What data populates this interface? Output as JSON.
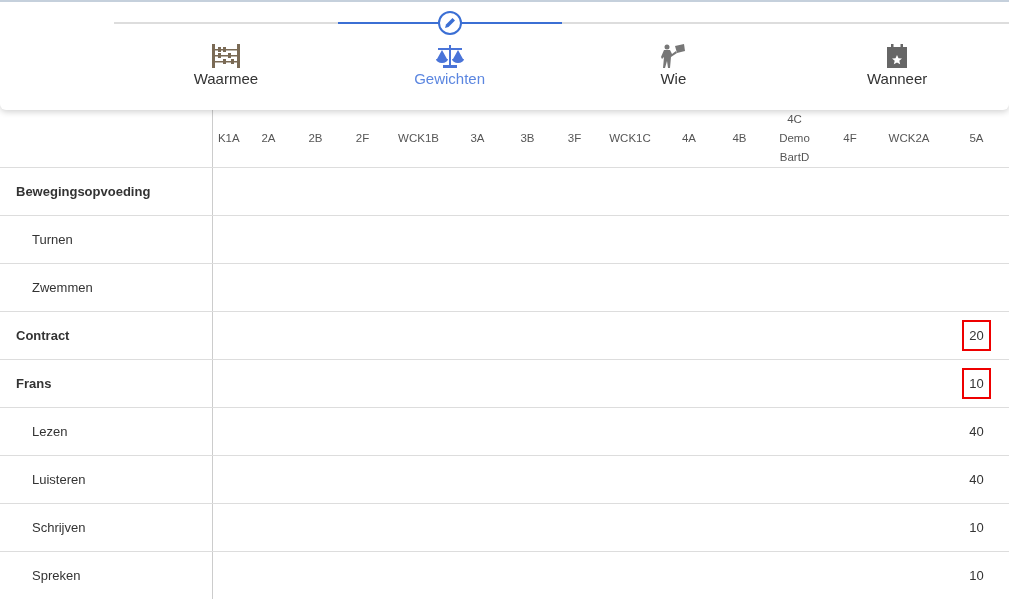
{
  "steps": [
    {
      "label": "Waarmee",
      "selected": false
    },
    {
      "label": "Gewichten",
      "selected": true
    },
    {
      "label": "Wie",
      "selected": false
    },
    {
      "label": "Wanneer",
      "selected": false
    }
  ],
  "table": {
    "columns": [
      "K1A",
      "2A",
      "2B",
      "2F",
      "WCK1B",
      "3A",
      "3B",
      "3F",
      "WCK1C",
      "4A",
      "4B",
      "4C Demo BartD",
      "4F",
      "WCK2A",
      "5A"
    ],
    "rows": [
      {
        "label": "Bewegingsopvoeding",
        "kind": "group",
        "value": null
      },
      {
        "label": "Turnen",
        "kind": "sub",
        "value": null
      },
      {
        "label": "Zwemmen",
        "kind": "sub",
        "value": null
      },
      {
        "label": "Contract",
        "kind": "group",
        "value": {
          "text": "20",
          "highlighted": true
        }
      },
      {
        "label": "Frans",
        "kind": "group",
        "value": {
          "text": "10",
          "highlighted": true
        }
      },
      {
        "label": "Lezen",
        "kind": "sub",
        "value": {
          "text": "40",
          "highlighted": false
        }
      },
      {
        "label": "Luisteren",
        "kind": "sub",
        "value": {
          "text": "40",
          "highlighted": false
        }
      },
      {
        "label": "Schrijven",
        "kind": "sub",
        "value": {
          "text": "10",
          "highlighted": false
        }
      },
      {
        "label": "Spreken",
        "kind": "sub",
        "value": {
          "text": "10",
          "highlighted": false
        }
      }
    ]
  }
}
